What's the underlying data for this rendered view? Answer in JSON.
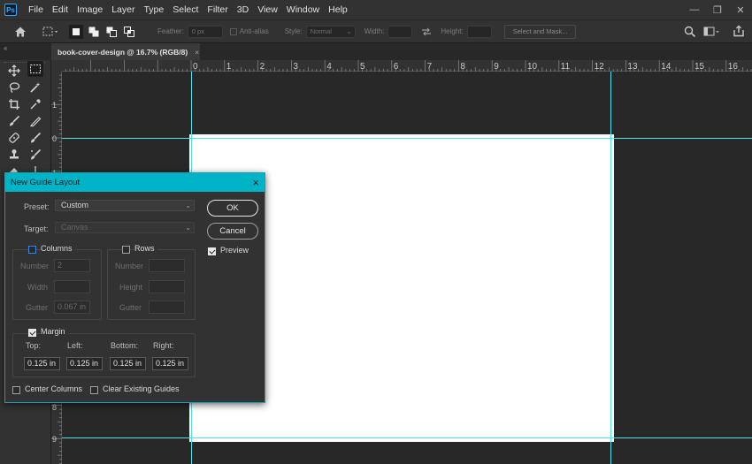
{
  "app": {
    "logo_text": "Ps"
  },
  "menu": [
    "File",
    "Edit",
    "Image",
    "Layer",
    "Type",
    "Select",
    "Filter",
    "3D",
    "View",
    "Window",
    "Help"
  ],
  "options_bar": {
    "feather_label": "Feather:",
    "feather_value": "0 px",
    "antialias_label": "Anti-alias",
    "style_label": "Style:",
    "style_value": "Normal",
    "width_label": "Width:",
    "height_label": "Height:",
    "select_mask_label": "Select and Mask..."
  },
  "tab": {
    "title": "book-cover-design @ 16.7% (RGB/8)",
    "close": "×"
  },
  "ruler_top_labels": [
    "0",
    "1",
    "2",
    "3",
    "4",
    "5",
    "6",
    "7",
    "8",
    "9",
    "10",
    "11",
    "12",
    "13",
    "14",
    "15",
    "16"
  ],
  "ruler_left_labels": [
    "1",
    "0",
    "1",
    "8",
    "9"
  ],
  "dialog": {
    "title": "New Guide Layout",
    "close": "×",
    "preset_label": "Preset:",
    "preset_value": "Custom",
    "target_label": "Target:",
    "target_value": "Canvas",
    "ok_label": "OK",
    "cancel_label": "Cancel",
    "preview_label": "Preview",
    "preview_checked": true,
    "columns": {
      "label": "Columns",
      "checked": false,
      "number_label": "Number",
      "number_value": "2",
      "width_label": "Width",
      "width_value": "",
      "gutter_label": "Gutter",
      "gutter_value": "0.067 in"
    },
    "rows": {
      "label": "Rows",
      "checked": false,
      "number_label": "Number",
      "height_label": "Height",
      "gutter_label": "Gutter"
    },
    "margin": {
      "label": "Margin",
      "checked": true,
      "top_label": "Top:",
      "left_label": "Left:",
      "bottom_label": "Bottom:",
      "right_label": "Right:",
      "top_value": "0.125 in",
      "left_value": "0.125 in",
      "bottom_value": "0.125 in",
      "right_value": "0.125 in"
    },
    "center_columns_label": "Center Columns",
    "clear_guides_label": "Clear Existing Guides"
  },
  "colors": {
    "guide": "#4fe0e8",
    "dialog_title_bar": "#00b3c6",
    "canvas_bg": "#282828",
    "document": "#ffffff"
  }
}
